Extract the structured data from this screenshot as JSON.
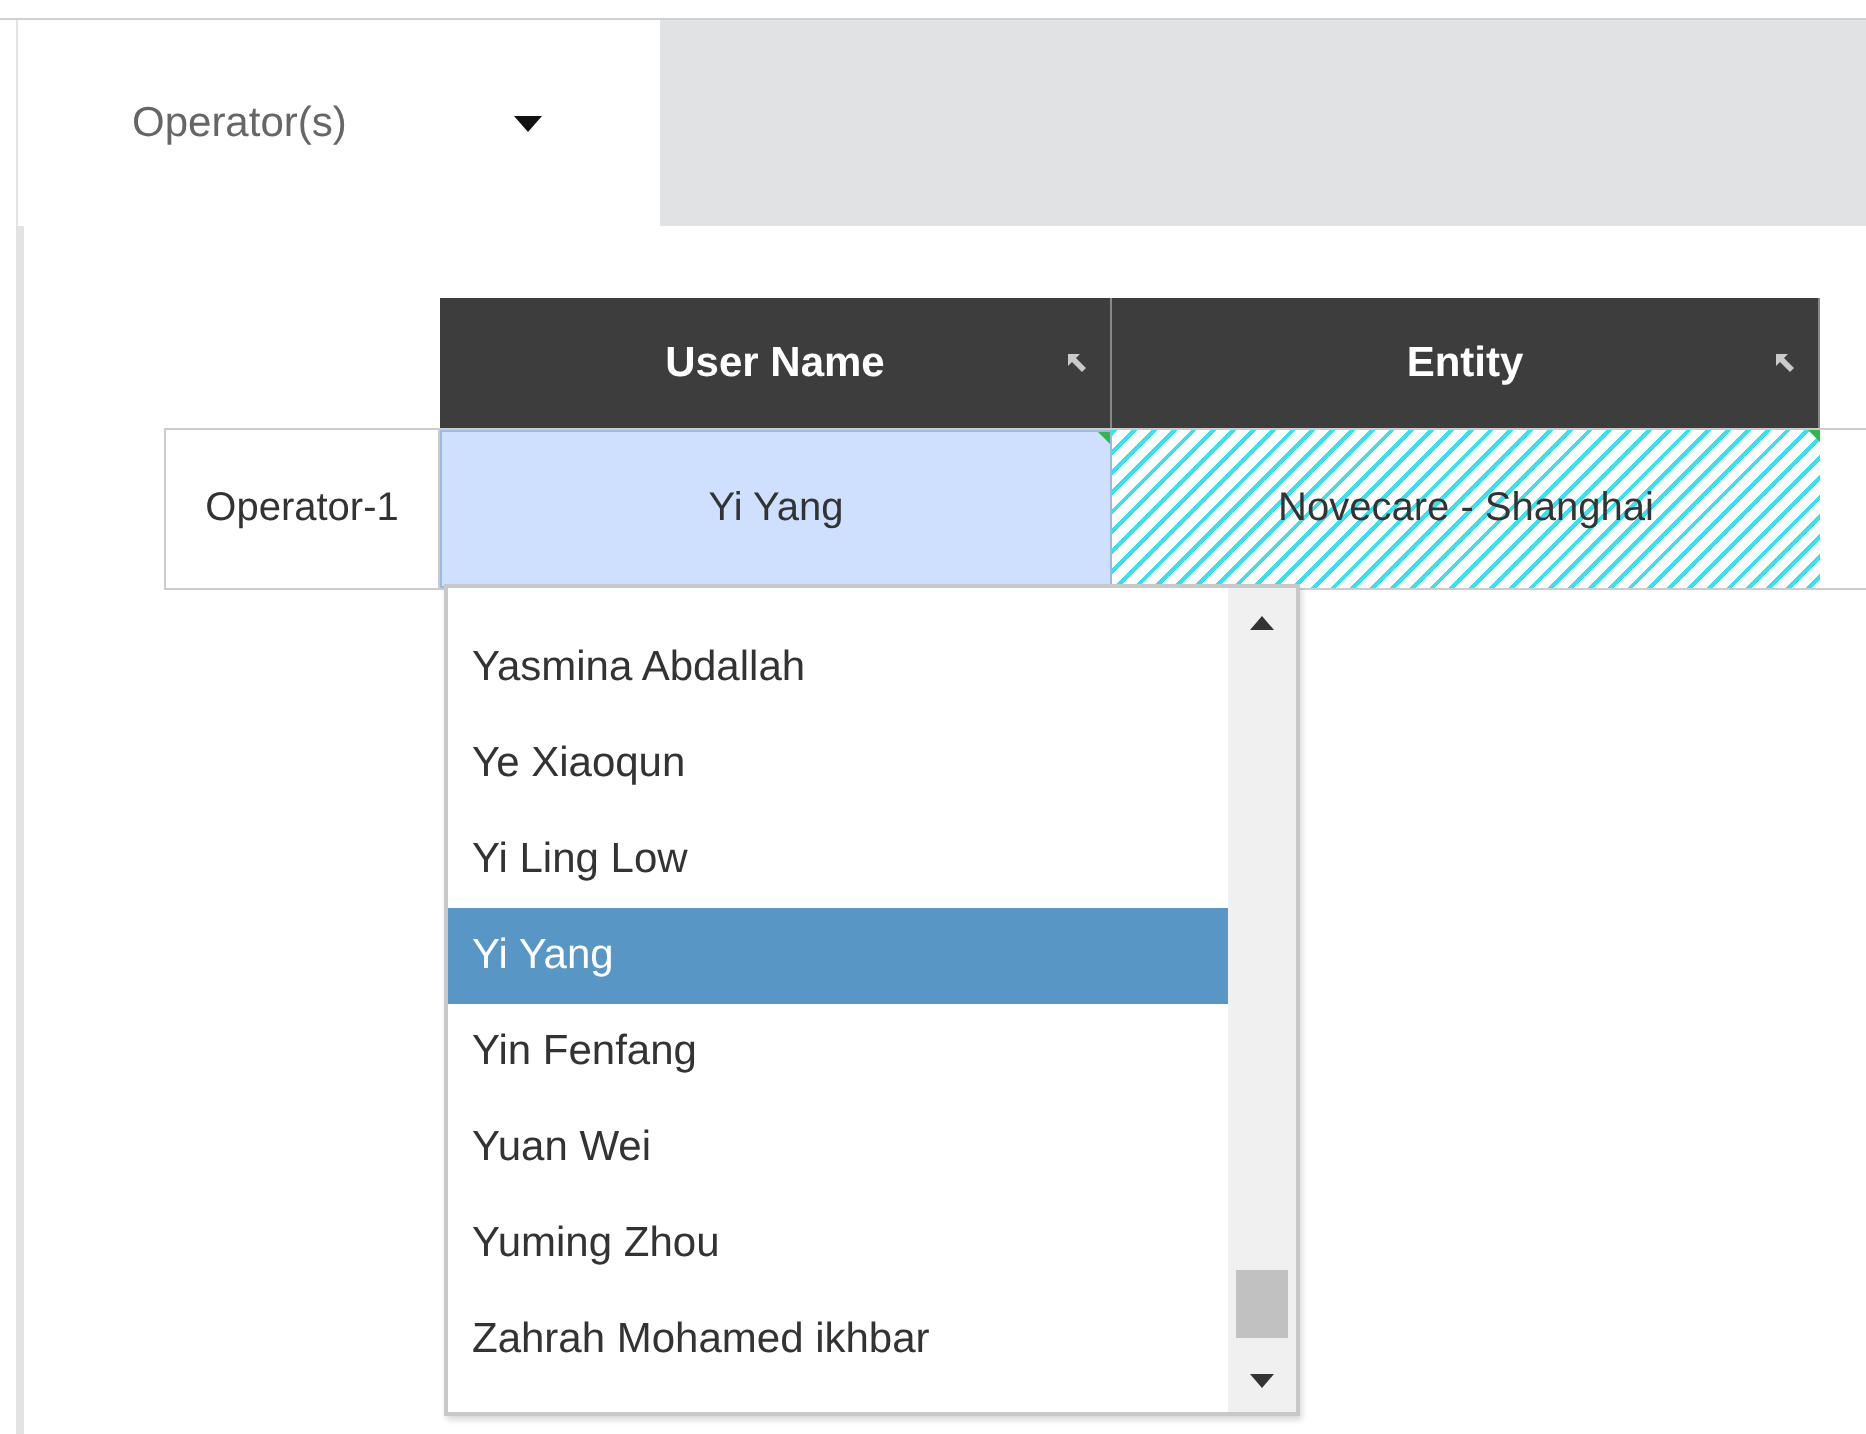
{
  "tab": {
    "label": "Operator(s)",
    "expanded": true
  },
  "table": {
    "columns": [
      "User Name",
      "Entity"
    ],
    "rows": [
      {
        "label": "Operator-1",
        "cells": [
          {
            "text": "Yi Yang",
            "kind": "editing"
          },
          {
            "text": "Novecare - Shanghai",
            "kind": "hatched"
          }
        ]
      }
    ]
  },
  "dropdown": {
    "items": [
      {
        "label": "Yasmina Abdallah",
        "selected": false
      },
      {
        "label": "Ye Xiaoqun",
        "selected": false
      },
      {
        "label": "Yi Ling Low",
        "selected": false
      },
      {
        "label": "Yi Yang",
        "selected": true
      },
      {
        "label": "Yin Fenfang",
        "selected": false
      },
      {
        "label": "Yuan Wei",
        "selected": false
      },
      {
        "label": "Yuming Zhou",
        "selected": false
      },
      {
        "label": "Zahrah Mohamed ikhbar",
        "selected": false
      }
    ]
  }
}
